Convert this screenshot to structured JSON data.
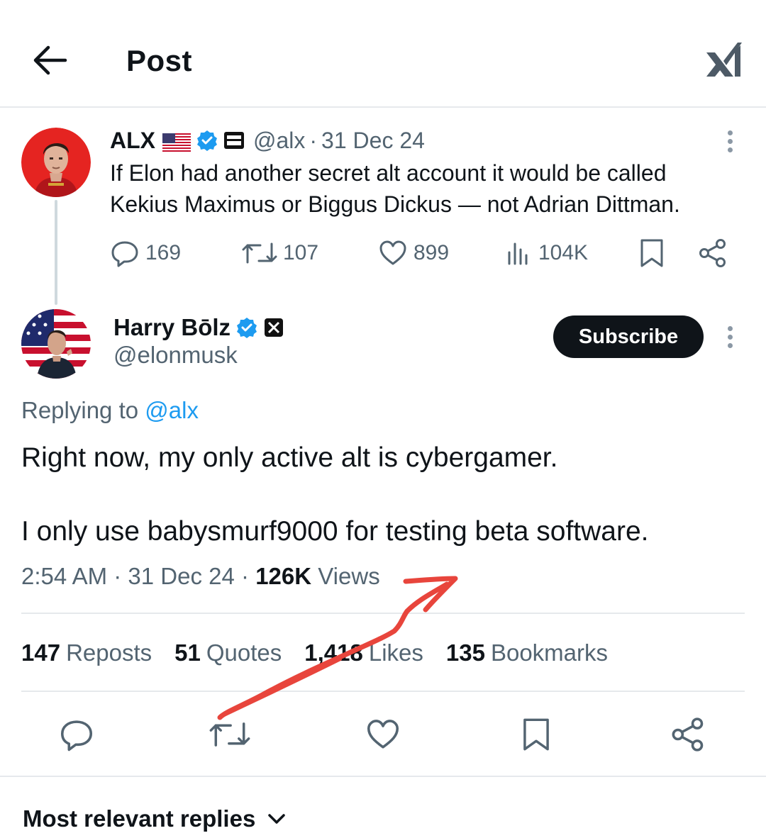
{
  "header": {
    "title": "Post",
    "back_icon": "arrow-left-icon",
    "logo_icon": "xai-logo-icon"
  },
  "quoted_post": {
    "display_name": "ALX",
    "handle": "@alx",
    "separator": "·",
    "date": "31 Dec 24",
    "text_line1": "If Elon had another secret alt account it would be called",
    "text_line2": "Kekius Maximus or Biggus Dickus — not Adrian Dittman.",
    "actions": {
      "replies": "169",
      "reposts": "107",
      "likes": "899",
      "views": "104K"
    }
  },
  "main_post": {
    "display_name": "Harry Bōlz",
    "handle": "@elonmusk",
    "subscribe_label": "Subscribe",
    "replying_prefix": "Replying to",
    "replying_handle": "@alx",
    "text_line1": "Right now, my only active alt is cybergamer.",
    "text_line2": "I only use babysmurf9000 for testing beta software.",
    "time": "2:54 AM",
    "separator": "·",
    "date": "31 Dec 24",
    "views_count": "126K",
    "views_label": "Views"
  },
  "stats": [
    {
      "count": "147",
      "label": "Reposts"
    },
    {
      "count": "51",
      "label": "Quotes"
    },
    {
      "count": "1,418",
      "label": "Likes"
    },
    {
      "count": "135",
      "label": "Bookmarks"
    }
  ],
  "replies_sort": {
    "label": "Most relevant replies"
  },
  "colors": {
    "accent": "#1d9bf0",
    "text": "#0f1419",
    "muted": "#536471",
    "annotation": "#e8453c"
  }
}
